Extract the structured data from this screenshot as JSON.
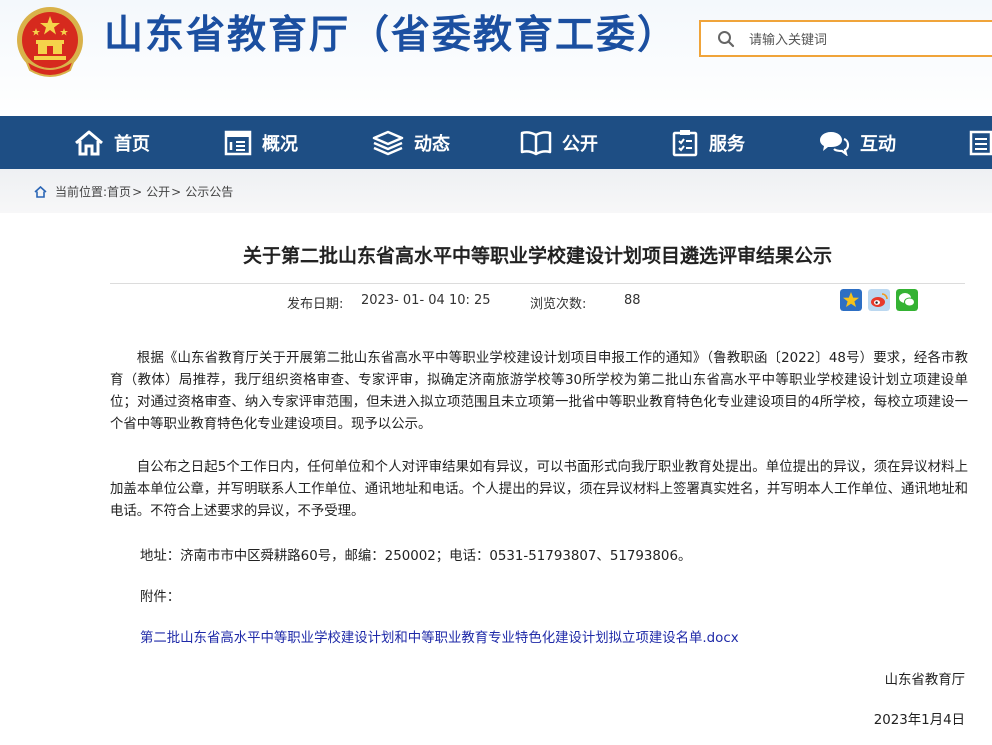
{
  "header": {
    "site_title": "山东省教育厅（省委教育工委）",
    "search": {
      "placeholder": "请输入关键词"
    }
  },
  "nav": {
    "items": [
      {
        "label": "首页",
        "icon": "home-icon"
      },
      {
        "label": "概况",
        "icon": "document-icon"
      },
      {
        "label": "动态",
        "icon": "layers-icon"
      },
      {
        "label": "公开",
        "icon": "book-icon"
      },
      {
        "label": "服务",
        "icon": "clipboard-icon"
      },
      {
        "label": "互动",
        "icon": "chat-icon"
      },
      {
        "label": "",
        "icon": "list-icon"
      }
    ]
  },
  "breadcrumb": {
    "prefix": "当前位置:",
    "items": [
      "首页",
      "公开",
      "公示公告"
    ],
    "separator": ">"
  },
  "article": {
    "title": "关于第二批山东省高水平中等职业学校建设计划项目遴选评审结果公示",
    "publish_label": "发布日期:",
    "publish_date": "2023- 01- 04 10: 25",
    "views_label": "浏览次数:",
    "views": "88",
    "share_icons": [
      "star-icon",
      "weibo-icon",
      "wechat-icon"
    ],
    "paragraphs": [
      "根据《山东省教育厅关于开展第二批山东省高水平中等职业学校建设计划项目申报工作的通知》（鲁教职函〔2022〕48号）要求，经各市教育（教体）局推荐，我厅组织资格审查、专家评审，拟确定济南旅游学校等30所学校为第二批山东省高水平中等职业学校建设计划立项建设单位；对通过资格审查、纳入专家评审范围，但未进入拟立项范围且未立项第一批省中等职业教育特色化专业建设项目的4所学校，每校立项建设一个省中等职业教育特色化专业建设项目。现予以公示。",
      "自公布之日起5个工作日内，任何单位和个人对评审结果如有异议，可以书面形式向我厅职业教育处提出。单位提出的异议，须在异议材料上加盖本单位公章，并写明联系人工作单位、通讯地址和电话。个人提出的异议，须在异议材料上签署真实姓名，并写明本人工作单位、通讯地址和电话。不符合上述要求的异议，不予受理。"
    ],
    "address": "地址：济南市市中区舜耕路60号，邮编：250002；电话：0531-51793807、51793806。",
    "attachment_label": "附件：",
    "attachment_link": "第二批山东省高水平中等职业学校建设计划和中等职业教育专业特色化建设计划拟立项建设名单.docx",
    "signature": "山东省教育厅",
    "sign_date": "2023年1月4日"
  },
  "colors": {
    "brand_blue": "#1b4fa0",
    "nav_bg": "#1e4e84",
    "search_border": "#f0a43a",
    "link_blue": "#1f2aa8"
  }
}
